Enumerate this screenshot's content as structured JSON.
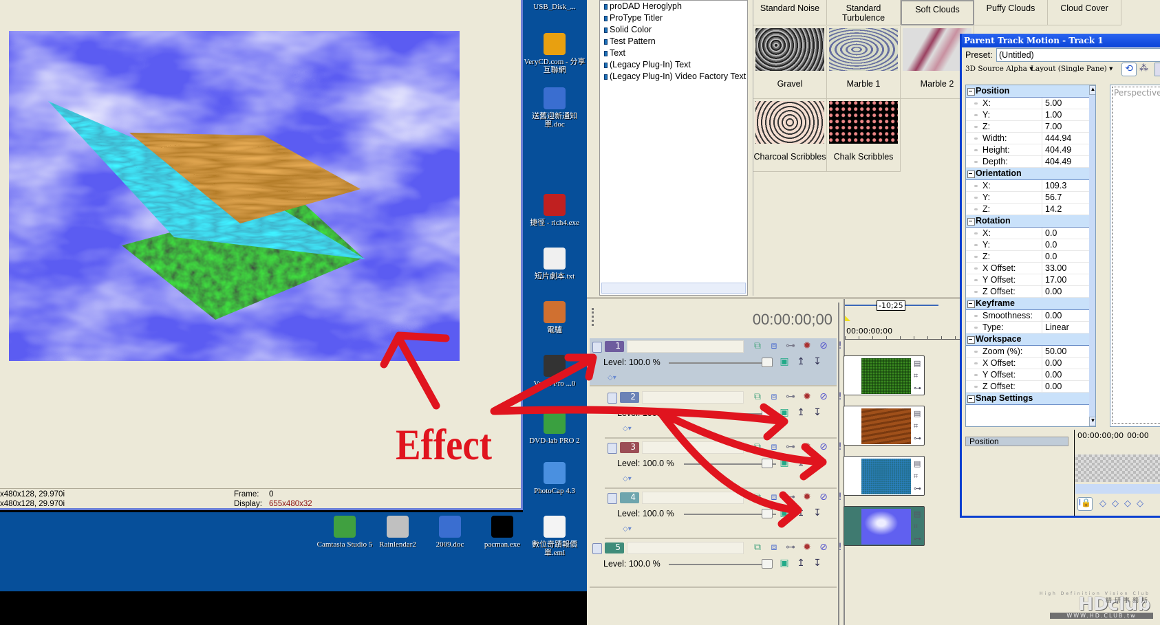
{
  "preview": {
    "status_line1": "x480x128, 29.970i",
    "status_line2": "x480x128, 29.970i",
    "frame_label": "Frame:",
    "frame_value": "0",
    "display_label": "Display:",
    "display_value": "655x480x32"
  },
  "annotation": {
    "text": "Effect",
    "color": "#e0141e"
  },
  "desktop": {
    "side_icons": [
      {
        "label": "USB_Disk_...",
        "icon": "usb-drive-icon"
      },
      {
        "label": "VeryCD.com - 分享互聯網",
        "icon": "verycd-icon"
      },
      {
        "label": "送舊迎新通知單.doc",
        "icon": "word-doc-icon"
      },
      {
        "label": "捷徑 - rich4.exe",
        "icon": "rich4-icon"
      },
      {
        "label": "短片劇本.txt",
        "icon": "text-file-icon"
      },
      {
        "label": "電驢",
        "icon": "emule-icon"
      },
      {
        "label": "Vegas Pro ...0",
        "icon": "vegas-icon"
      },
      {
        "label": "DVD-lab PRO 2",
        "icon": "dvdlab-icon"
      },
      {
        "label": "PhotoCap 4.3",
        "icon": "photocap-icon"
      }
    ],
    "bottom_icons": [
      {
        "label": "Camtasia Studio 5",
        "icon": "camtasia-icon"
      },
      {
        "label": "Rainlendar2",
        "icon": "rainlendar-icon"
      },
      {
        "label": "2009.doc",
        "icon": "word-doc-icon"
      },
      {
        "label": "pacman.exe",
        "icon": "pacman-icon"
      },
      {
        "label": "數位奇蹟報價單.eml",
        "icon": "email-icon"
      }
    ]
  },
  "generators": {
    "list": [
      "proDAD Heroglyph",
      "ProType Titler",
      "Solid Color",
      "Test Pattern",
      "Text",
      "(Legacy Plug-In) Text",
      "(Legacy Plug-In) Video Factory Text"
    ],
    "presets_header": [
      "Standard Noise",
      "Standard Turbulence",
      "Soft Clouds",
      "Puffy Clouds",
      "Cloud Cover"
    ],
    "presets": [
      "Gravel",
      "Marble 1",
      "Marble 2",
      "Charcoal Scribbles",
      "Chalk Scribbles"
    ],
    "selected_header": "Soft Clouds"
  },
  "timeline": {
    "timecode": "00:00:00;00",
    "ruler_start": "00:00:00;00",
    "loop_length": "-10;25",
    "tracks": [
      {
        "num": "1",
        "level": "Level: 100.0 %",
        "color": "#6e5c9e",
        "selected": true
      },
      {
        "num": "2",
        "level": "Level: 100.0 %",
        "color": "#6b82b6",
        "selected": false
      },
      {
        "num": "3",
        "level": "Level: 100.0 %",
        "color": "#9c4d55",
        "selected": false
      },
      {
        "num": "4",
        "level": "Level: 100.0 %",
        "color": "#6ea5ad",
        "selected": false
      },
      {
        "num": "5",
        "level": "Level: 100.0 %",
        "color": "#3f8c7a",
        "selected": false
      }
    ]
  },
  "dialog": {
    "title": "Parent Track Motion - Track 1",
    "preset_label": "Preset:",
    "preset_value": "(Untitled)",
    "source_alpha": "3D Source Alpha",
    "layout": "Layout (Single Pane)",
    "perspective_label": "Perspective",
    "groups": [
      {
        "name": "Position",
        "rows": [
          [
            "X:",
            "5.00"
          ],
          [
            "Y:",
            "1.00"
          ],
          [
            "Z:",
            "7.00"
          ],
          [
            "Width:",
            "444.94"
          ],
          [
            "Height:",
            "404.49"
          ],
          [
            "Depth:",
            "404.49"
          ]
        ]
      },
      {
        "name": "Orientation",
        "rows": [
          [
            "X:",
            "109.3"
          ],
          [
            "Y:",
            "56.7"
          ],
          [
            "Z:",
            "14.2"
          ]
        ]
      },
      {
        "name": "Rotation",
        "rows": [
          [
            "X:",
            "0.0"
          ],
          [
            "Y:",
            "0.0"
          ],
          [
            "Z:",
            "0.0"
          ],
          [
            "X Offset:",
            "33.00"
          ],
          [
            "Y Offset:",
            "17.00"
          ],
          [
            "Z Offset:",
            "0.00"
          ]
        ]
      },
      {
        "name": "Keyframe",
        "rows": [
          [
            "Smoothness:",
            "0.00"
          ],
          [
            "Type:",
            "Linear"
          ]
        ]
      },
      {
        "name": "Workspace",
        "rows": [
          [
            "Zoom (%):",
            "50.00"
          ],
          [
            "X Offset:",
            "0.00"
          ],
          [
            "Y Offset:",
            "0.00"
          ],
          [
            "Z Offset:",
            "0.00"
          ]
        ]
      },
      {
        "name": "Snap Settings",
        "rows": []
      }
    ],
    "kf_track_label": "Position",
    "kf_ruler_start": "00:00:00;00",
    "kf_ruler_next": "00:00"
  },
  "watermark": {
    "tagline": "High Definition Vision Club",
    "brand": "HDclub",
    "cjk": "精研事務所",
    "url": "WWW.HD.CLUB.tw"
  }
}
